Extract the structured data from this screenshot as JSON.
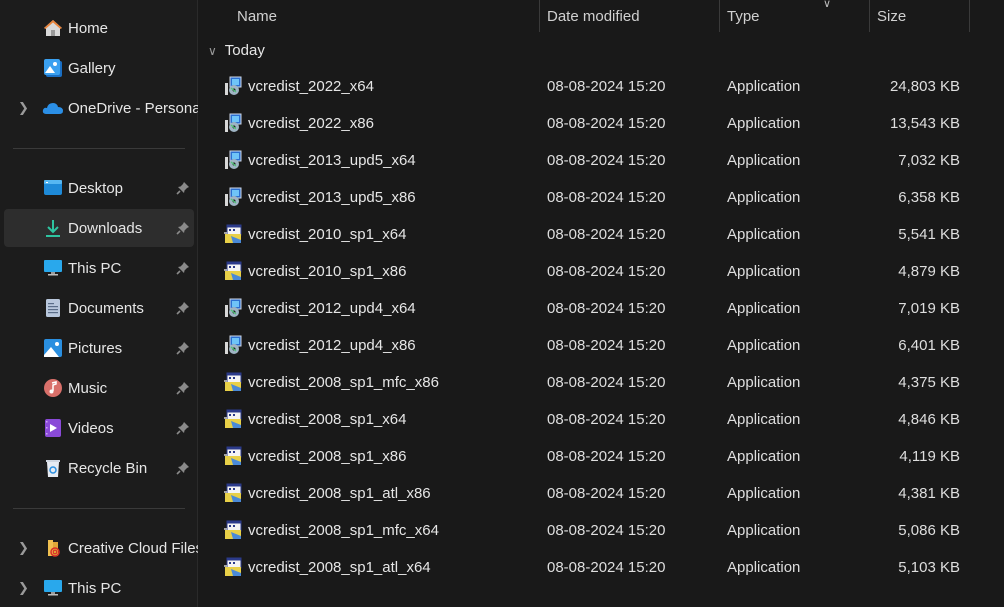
{
  "sidebar": {
    "top_items": [
      {
        "label": "Home",
        "icon": "home-icon"
      },
      {
        "label": "Gallery",
        "icon": "gallery-icon"
      },
      {
        "label": "OneDrive - Personal",
        "icon": "onedrive-icon",
        "expandable": true
      }
    ],
    "quick_access": [
      {
        "label": "Desktop",
        "icon": "desktop-icon",
        "pinned": true
      },
      {
        "label": "Downloads",
        "icon": "downloads-icon",
        "pinned": true,
        "selected": true
      },
      {
        "label": "This PC",
        "icon": "this-pc-icon",
        "pinned": true
      },
      {
        "label": "Documents",
        "icon": "documents-icon",
        "pinned": true
      },
      {
        "label": "Pictures",
        "icon": "pictures-icon",
        "pinned": true
      },
      {
        "label": "Music",
        "icon": "music-icon",
        "pinned": true
      },
      {
        "label": "Videos",
        "icon": "videos-icon",
        "pinned": true
      },
      {
        "label": "Recycle Bin",
        "icon": "recycle-bin-icon",
        "pinned": true
      }
    ],
    "bottom_items": [
      {
        "label": "Creative Cloud Files",
        "icon": "creative-cloud-folder-icon",
        "expandable": true
      },
      {
        "label": "This PC",
        "icon": "this-pc-icon",
        "expandable": true
      }
    ]
  },
  "columns": {
    "name": "Name",
    "date": "Date modified",
    "type": "Type",
    "size": "Size"
  },
  "sort_indicator": "chevron-down-icon",
  "group": {
    "label": "Today"
  },
  "files": [
    {
      "name": "vcredist_2022_x64",
      "date": "08-08-2024 15:20",
      "type": "Application",
      "size": "24,803 KB",
      "icon": "installer-cd"
    },
    {
      "name": "vcredist_2022_x86",
      "date": "08-08-2024 15:20",
      "type": "Application",
      "size": "13,543 KB",
      "icon": "installer-cd"
    },
    {
      "name": "vcredist_2013_upd5_x64",
      "date": "08-08-2024 15:20",
      "type": "Application",
      "size": "7,032 KB",
      "icon": "installer-cd"
    },
    {
      "name": "vcredist_2013_upd5_x86",
      "date": "08-08-2024 15:20",
      "type": "Application",
      "size": "6,358 KB",
      "icon": "installer-cd"
    },
    {
      "name": "vcredist_2010_sp1_x64",
      "date": "08-08-2024 15:20",
      "type": "Application",
      "size": "5,541 KB",
      "icon": "installer-box"
    },
    {
      "name": "vcredist_2010_sp1_x86",
      "date": "08-08-2024 15:20",
      "type": "Application",
      "size": "4,879 KB",
      "icon": "installer-box"
    },
    {
      "name": "vcredist_2012_upd4_x64",
      "date": "08-08-2024 15:20",
      "type": "Application",
      "size": "7,019 KB",
      "icon": "installer-cd"
    },
    {
      "name": "vcredist_2012_upd4_x86",
      "date": "08-08-2024 15:20",
      "type": "Application",
      "size": "6,401 KB",
      "icon": "installer-cd"
    },
    {
      "name": "vcredist_2008_sp1_mfc_x86",
      "date": "08-08-2024 15:20",
      "type": "Application",
      "size": "4,375 KB",
      "icon": "installer-box"
    },
    {
      "name": "vcredist_2008_sp1_x64",
      "date": "08-08-2024 15:20",
      "type": "Application",
      "size": "4,846 KB",
      "icon": "installer-box"
    },
    {
      "name": "vcredist_2008_sp1_x86",
      "date": "08-08-2024 15:20",
      "type": "Application",
      "size": "4,119 KB",
      "icon": "installer-box"
    },
    {
      "name": "vcredist_2008_sp1_atl_x86",
      "date": "08-08-2024 15:20",
      "type": "Application",
      "size": "4,381 KB",
      "icon": "installer-box"
    },
    {
      "name": "vcredist_2008_sp1_mfc_x64",
      "date": "08-08-2024 15:20",
      "type": "Application",
      "size": "5,086 KB",
      "icon": "installer-box"
    },
    {
      "name": "vcredist_2008_sp1_atl_x64",
      "date": "08-08-2024 15:20",
      "type": "Application",
      "size": "5,103 KB",
      "icon": "installer-box"
    }
  ]
}
